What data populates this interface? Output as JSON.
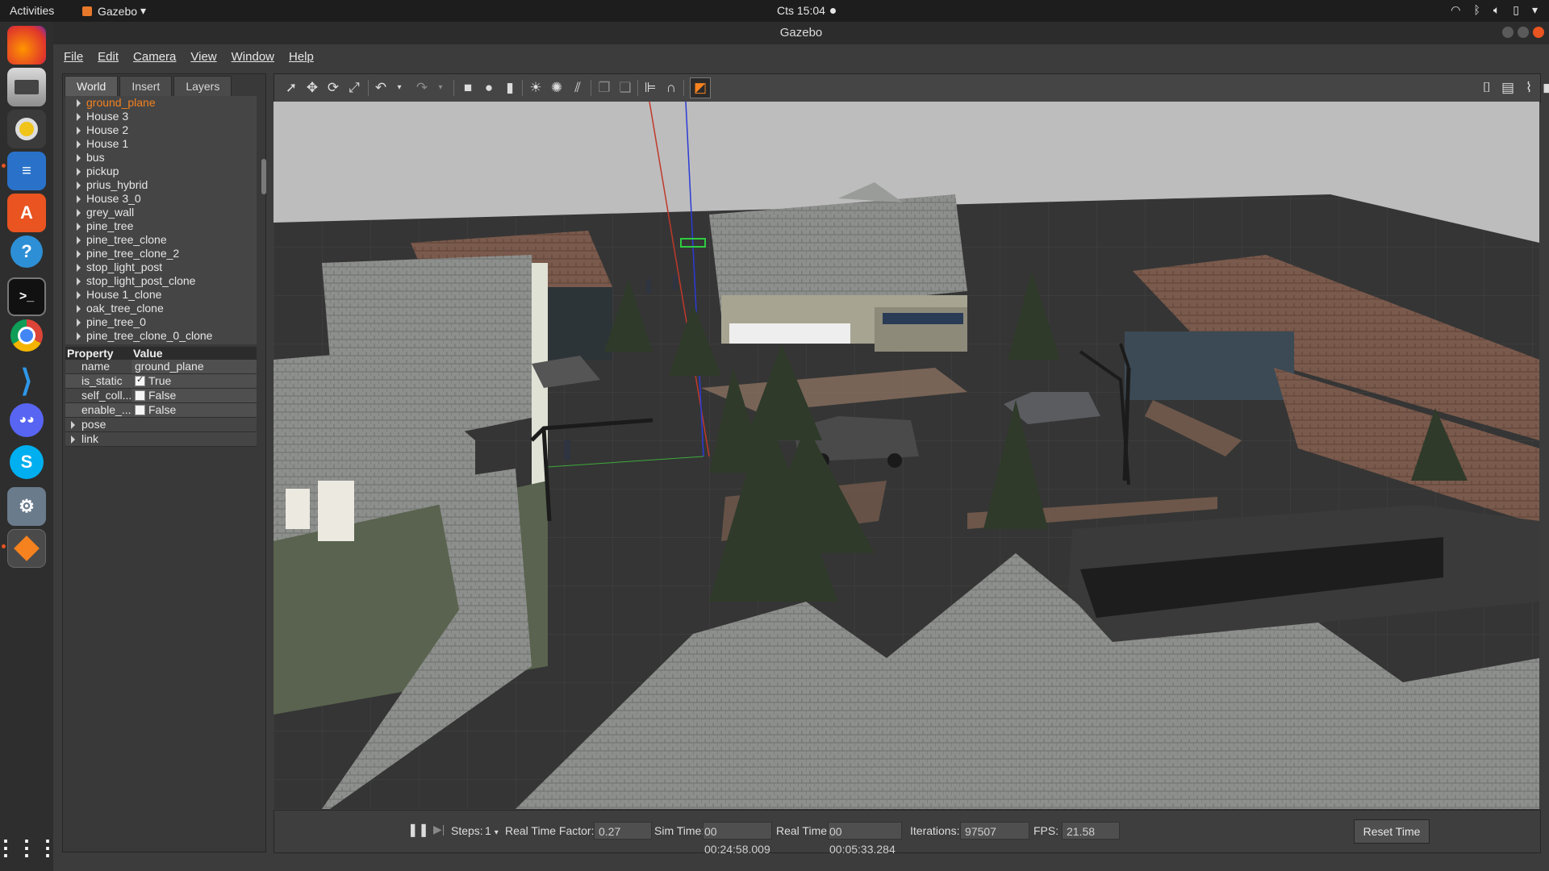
{
  "topbar": {
    "activities": "Activities",
    "app_name": "Gazebo",
    "clock": "Cts 15:04"
  },
  "window": {
    "title": "Gazebo"
  },
  "menu": {
    "file": "File",
    "edit": "Edit",
    "camera": "Camera",
    "view": "View",
    "window": "Window",
    "help": "Help"
  },
  "left_panel": {
    "tabs": [
      "World",
      "Insert",
      "Layers"
    ],
    "tree": [
      "ground_plane",
      "House 3",
      "House 2",
      "House 1",
      "bus",
      "pickup",
      "prius_hybrid",
      "House 3_0",
      "grey_wall",
      "pine_tree",
      "pine_tree_clone",
      "pine_tree_clone_2",
      "stop_light_post",
      "stop_light_post_clone",
      "House 1_clone",
      "oak_tree_clone",
      "pine_tree_0",
      "pine_tree_clone_0_clone"
    ],
    "props_header": {
      "property": "Property",
      "value": "Value"
    },
    "props": {
      "name_k": "name",
      "name_v": "ground_plane",
      "static_k": "is_static",
      "static_v": "True",
      "selfcoll_k": "self_coll...",
      "selfcoll_v": "False",
      "enable_k": "enable_...",
      "enable_v": "False",
      "pose": "pose",
      "link": "link"
    }
  },
  "status": {
    "steps_label": "Steps:",
    "steps_value": "1",
    "rtf_label": "Real Time Factor:",
    "rtf_value": "0.27",
    "sim_label": "Sim Time:",
    "sim_value": "00 00:24:58.009",
    "real_label": "Real Time:",
    "real_value": "00 00:05:33.284",
    "iter_label": "Iterations:",
    "iter_value": "97507",
    "fps_label": "FPS:",
    "fps_value": "21.58",
    "reset": "Reset Time"
  },
  "colors": {
    "accent": "#f5821f",
    "close": "#e95420"
  }
}
